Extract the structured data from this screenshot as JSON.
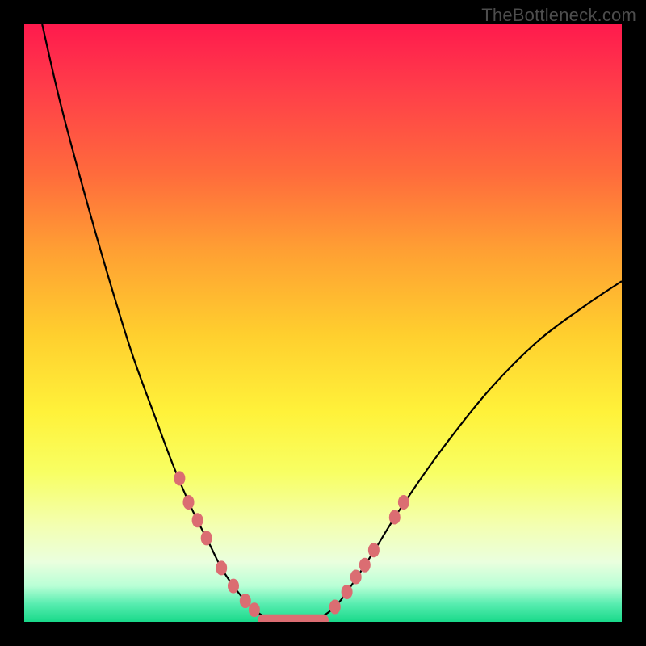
{
  "attribution": "TheBottleneck.com",
  "colors": {
    "background": "#000000",
    "gradient_top": "#ff1a4d",
    "gradient_bottom": "#19d98a",
    "curve": "#000000",
    "marker": "#db6d72"
  },
  "chart_data": {
    "type": "line",
    "title": "",
    "xlabel": "",
    "ylabel": "",
    "xlim": [
      0,
      100
    ],
    "ylim": [
      0,
      100
    ],
    "series": [
      {
        "name": "bottleneck-curve",
        "x": [
          3,
          6,
          10,
          14,
          18,
          22,
          25,
          28,
          31,
          33,
          35,
          37,
          38.5,
          40,
          42,
          44,
          46,
          48,
          50,
          52,
          54,
          58,
          63,
          70,
          78,
          86,
          94,
          100
        ],
        "y": [
          100,
          87,
          72,
          58,
          45,
          34,
          26,
          19,
          13,
          9,
          6,
          3.5,
          2,
          1,
          0.3,
          0,
          0,
          0.3,
          1,
          2.5,
          5,
          11,
          19,
          29,
          39,
          47,
          53,
          57
        ]
      }
    ],
    "markers": {
      "name": "highlight-points",
      "points": [
        {
          "x": 26.0,
          "y": 24.0
        },
        {
          "x": 27.5,
          "y": 20.0
        },
        {
          "x": 29.0,
          "y": 17.0
        },
        {
          "x": 30.5,
          "y": 14.0
        },
        {
          "x": 33.0,
          "y": 9.0
        },
        {
          "x": 35.0,
          "y": 6.0
        },
        {
          "x": 37.0,
          "y": 3.5
        },
        {
          "x": 38.5,
          "y": 2.0
        },
        {
          "x": 52.0,
          "y": 2.5
        },
        {
          "x": 54.0,
          "y": 5.0
        },
        {
          "x": 55.5,
          "y": 7.5
        },
        {
          "x": 57.0,
          "y": 9.5
        },
        {
          "x": 58.5,
          "y": 12.0
        },
        {
          "x": 62.0,
          "y": 17.5
        },
        {
          "x": 63.5,
          "y": 20.0
        }
      ]
    },
    "flat_segment": {
      "x0": 40,
      "x1": 50,
      "y": 0.3
    }
  }
}
